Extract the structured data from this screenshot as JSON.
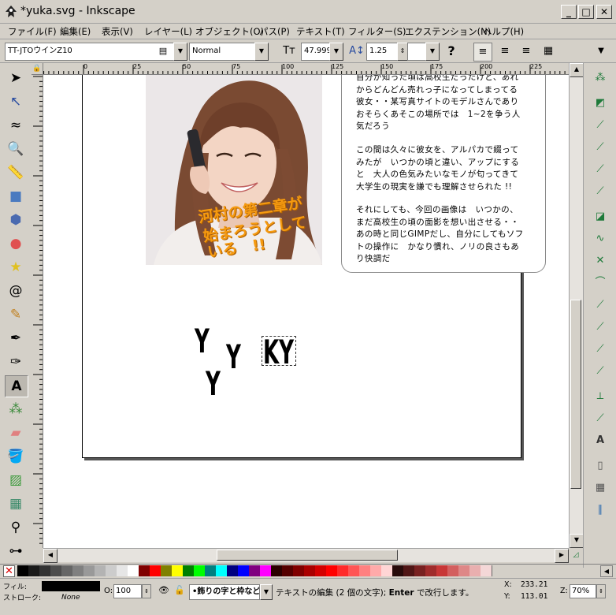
{
  "window": {
    "title": "*yuka.svg - Inkscape"
  },
  "menu": [
    "ファイル(F)",
    "編集(E)",
    "表示(V)",
    "レイヤー(L)",
    "オブジェクト(O)",
    "パス(P)",
    "テキスト(T)",
    "フィルター(S)",
    "エクステンション(N)",
    "ヘルプ(H)"
  ],
  "textbar": {
    "font_family": "TT-JTOウインZ10",
    "font_style": "Normal",
    "font_size": "47.999",
    "line_spacing": "1.25",
    "letter_spacing": ""
  },
  "ruler_top": [
    "0",
    "25",
    "50",
    "75",
    "100",
    "125",
    "150",
    "175",
    "200",
    "225"
  ],
  "ruler_left": [
    "2",
    "2",
    "2",
    "1",
    "1",
    "1",
    "1",
    "1",
    "7",
    "5",
    "2",
    "0",
    "7",
    "5",
    "2",
    "5",
    "0"
  ],
  "document": {
    "overlay_text": [
      "河村の第二章が",
      "始まろうとして",
      "いる　!!"
    ],
    "paragraph1": "自分が知った頃は高校生だったけど、あれ\nからどんどん売れっ子になってしまってる\n彼女・・某写真サイトのモデルさんであり\nおそらくあそこの場所では　1~2を争う人\n気だろう",
    "paragraph2": "この間は久々に彼女を、アルパカで綴って\nみたが　いつかの頃と違い、アップにする\nと　大人の色気みたいなモノが匂ってきて\n大学生の現実を嫌でも理解させられた !!",
    "paragraph3": "それにしても、今回の画像は　いつかの、\nまだ高校生の頃の面影を想い出させる・・\nあの時と同じGIMPだし、自分にしてもソフ\nトの操作に　かなり慣れ、ノリの良さもあ\nり快調だ",
    "y_glyph": "Y",
    "ky_text": "KY"
  },
  "palette": [
    "#000000",
    "#1a1a1a",
    "#333333",
    "#4d4d4d",
    "#666666",
    "#808080",
    "#999999",
    "#b3b3b3",
    "#cccccc",
    "#e6e6e6",
    "#ffffff",
    "#800000",
    "#ff0000",
    "#808000",
    "#ffff00",
    "#008000",
    "#00ff00",
    "#008080",
    "#00ffff",
    "#000080",
    "#0000ff",
    "#800080",
    "#ff00ff",
    "#2b0000",
    "#550000",
    "#800000",
    "#aa0000",
    "#d40000",
    "#ff0000",
    "#ff2a2a",
    "#ff5555",
    "#ff8080",
    "#ffaaaa",
    "#ffd5d5",
    "#280b0b",
    "#501616",
    "#782121",
    "#a02c2c",
    "#c83737",
    "#d35f5f",
    "#de8787",
    "#e9afaf",
    "#f4d7d7"
  ],
  "status": {
    "fill_label": "フィル:",
    "stroke_label": "ストローク:",
    "stroke_value": "None",
    "opacity_label": "O:",
    "opacity_value": "100",
    "layer_value": "•飾りの字と枠など",
    "message_prefix": "テキストの編集 (2 個の文字);",
    "message_bold": "Enter",
    "message_suffix": "で改行します。",
    "x_label": "X:",
    "x_value": "233.21",
    "y_label": "Y:",
    "y_value": "113.01",
    "z_label": "Z:",
    "zoom": "70%"
  },
  "colors": {
    "overlay_text": "#f59a10",
    "tool_green": "#1e7a3a"
  }
}
